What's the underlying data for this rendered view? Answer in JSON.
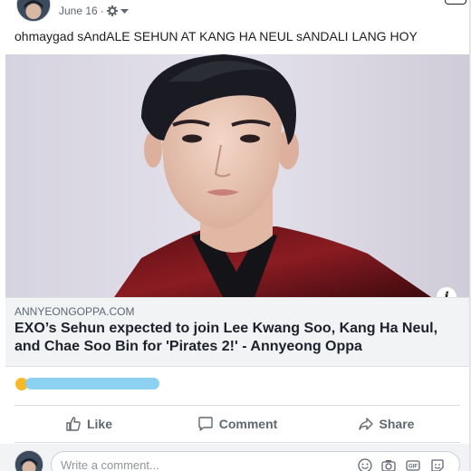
{
  "post": {
    "date": "June 16",
    "separator": "·",
    "text": "ohmaygad sAndALE SEHUN AT KANG HA NEUL sANDALI LANG HOY"
  },
  "link_preview": {
    "domain": "ANNYEONGOPPA.COM",
    "title": "EXO’s Sehun expected to join Lee Kwang Soo, Kang Ha Neul, and Chae Soo Bin for 'Pirates 2!' - Annyeong Oppa",
    "info_icon": "i"
  },
  "actions": {
    "like": "Like",
    "comment": "Comment",
    "share": "Share"
  },
  "comment": {
    "placeholder": "Write a comment..."
  },
  "icons": {
    "gear": "gear-icon",
    "like": "thumbs-up-icon",
    "comment": "speech-bubble-icon",
    "share": "share-arrow-icon",
    "emoji": "smiley-icon",
    "camera": "camera-icon",
    "gif": "gif-icon",
    "sticker": "sticker-icon"
  },
  "colors": {
    "secondary_text": "#606770",
    "link_box_bg": "#f2f3f5",
    "redaction": "#86cfee"
  }
}
